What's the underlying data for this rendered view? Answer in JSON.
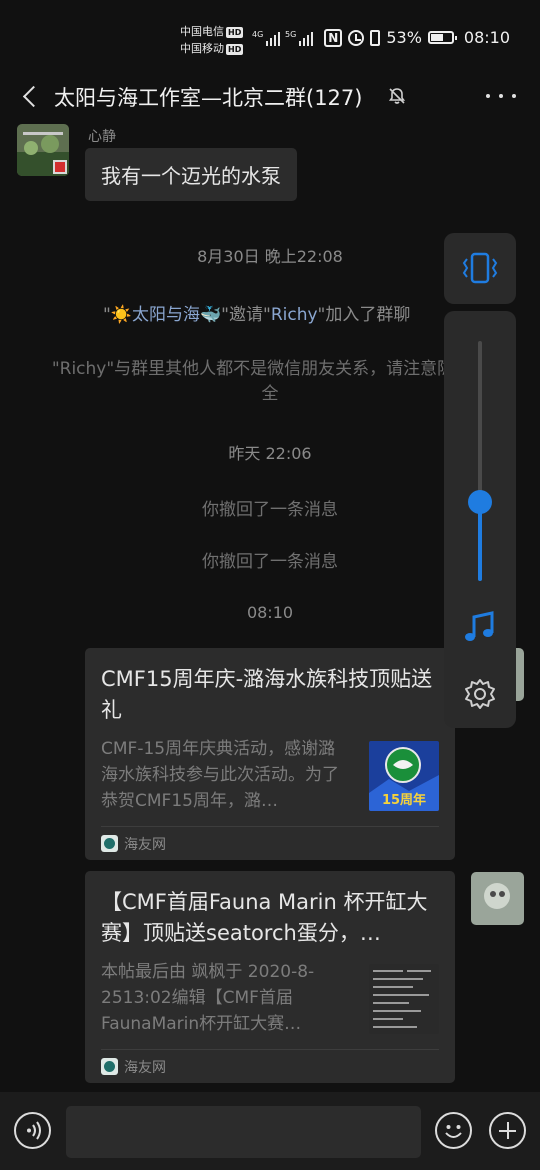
{
  "status_bar": {
    "carrier_1": "中国电信",
    "carrier_2": "中国移动",
    "hd_badge": "HD",
    "net_1": "4G",
    "net_2": "5G",
    "nfc_label": "N",
    "battery_percent": "53%",
    "battery_level": 0.53,
    "time": "08:10"
  },
  "header": {
    "title": "太阳与海工作室—北京二群(127)",
    "icons": [
      "back-arrow-icon",
      "mute-bell-icon",
      "more-dots-icon"
    ]
  },
  "messages": {
    "first": {
      "sender": "心静",
      "text": "我有一个迈光的水泵"
    },
    "time_1": "8月30日 晚上22:08",
    "invite": {
      "quote_open": "\"",
      "sun_emoji": "☀️",
      "inviter": "太阳与海",
      "whale_emoji": "🐳",
      "mid": "\"邀请\"",
      "invitee": "Richy",
      "end": "\"加入了群聊"
    },
    "notice": "\"Richy\"与群里其他人都不是微信朋友关系，请注意隐私安全",
    "time_2": "昨天 22:06",
    "recall_1": "你撤回了一条消息",
    "recall_2": "你撤回了一条消息",
    "time_3": "08:10"
  },
  "cards": [
    {
      "title": "CMF15周年庆-潞海水族科技顶贴送礼",
      "desc": "CMF-15周年庆典活动，感谢潞海水族科技参与此次活动。为了恭贺CMF15周年，潞…",
      "thumb_text": "15周年",
      "source": "海友网"
    },
    {
      "title": "【CMF首届Fauna Marin 杯开缸大赛】顶贴送seatorch蛋分，…",
      "desc": "本帖最后由 飒枫于 2020-8-2513:02编辑【CMF首届FaunaMarin杯开缸大赛…",
      "source": "海友网"
    }
  ],
  "volume_panel": {
    "level": 0.33,
    "icons": [
      "vibrate-icon",
      "music-note-icon",
      "gear-icon"
    ]
  },
  "input_bar": {
    "placeholder": "",
    "icons": [
      "voice-icon",
      "emoji-icon",
      "plus-icon"
    ]
  },
  "colors": {
    "background": "#111111",
    "bubble": "#2c2c2c",
    "accent_blue": "#1f7ce0"
  }
}
